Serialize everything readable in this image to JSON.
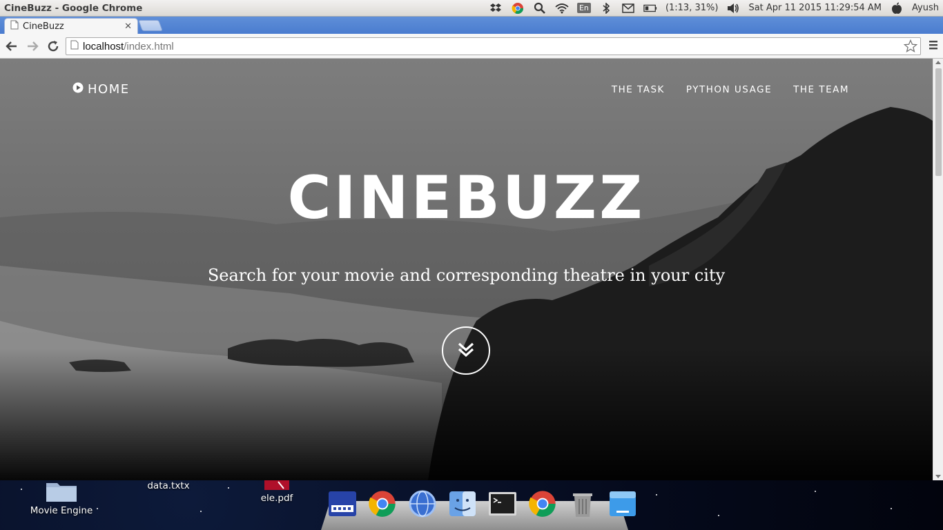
{
  "window": {
    "title": "CineBuzz - Google Chrome"
  },
  "system_tray": {
    "language": "En",
    "battery": "(1:13, 31%)",
    "datetime": "Sat Apr 11 2015 11:29:54 AM",
    "user": "Ayush"
  },
  "tabs": [
    {
      "label": "CineBuzz"
    }
  ],
  "address_bar": {
    "host": "localhost",
    "path": "/index.html"
  },
  "page": {
    "nav": {
      "home_label": "HOME",
      "links": [
        "THE TASK",
        "PYTHON USAGE",
        "THE TEAM"
      ]
    },
    "hero": {
      "title": "CINEBUZZ",
      "subtitle": "Search for your movie and corresponding theatre in your city"
    }
  },
  "desktop": {
    "items": [
      "Movie Engine",
      "data.txtx",
      "ele.pdf"
    ]
  }
}
